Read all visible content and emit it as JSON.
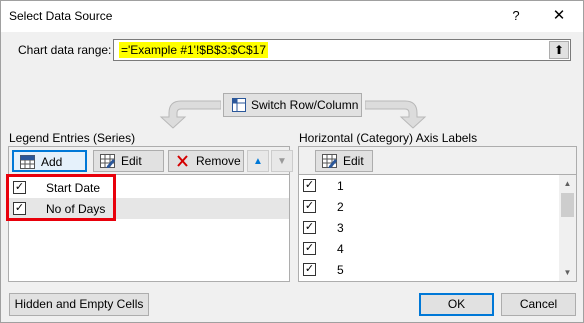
{
  "window": {
    "title": "Select Data Source",
    "help_label": "?",
    "close_label": "✕"
  },
  "range": {
    "label": "Chart data range:",
    "value": "='Example #1'!$B$3:$C$17",
    "collapse_label": "⬆"
  },
  "switch_button": {
    "label": "Switch Row/Column"
  },
  "legend": {
    "title": "Legend Entries (Series)",
    "add_label": "Add",
    "edit_label": "Edit",
    "remove_label": "Remove",
    "move_up_label": "▲",
    "move_down_label": "▼",
    "series": [
      {
        "label": "Start Date",
        "checked": true
      },
      {
        "label": "No of Days",
        "checked": true,
        "selected": true
      }
    ]
  },
  "axis": {
    "title": "Horizontal (Category) Axis Labels",
    "edit_label": "Edit",
    "items": [
      {
        "label": "1",
        "checked": true
      },
      {
        "label": "2",
        "checked": true
      },
      {
        "label": "3",
        "checked": true
      },
      {
        "label": "4",
        "checked": true
      },
      {
        "label": "5",
        "checked": true
      }
    ]
  },
  "footer": {
    "hidden_cells_label": "Hidden and Empty Cells",
    "ok_label": "OK",
    "cancel_label": "Cancel"
  },
  "colors": {
    "highlight": "#ffff00",
    "annotation_box": "#e8000b",
    "focus": "#0078d7",
    "remove_icon": "#d40000"
  }
}
